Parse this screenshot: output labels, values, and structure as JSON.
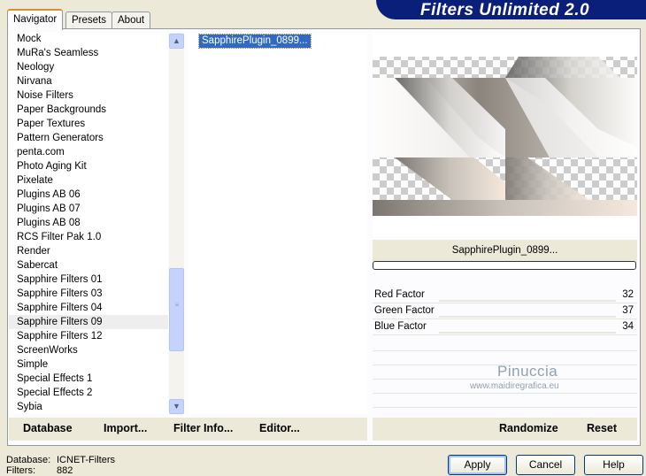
{
  "tabs": [
    {
      "label": "Navigator",
      "active": true
    },
    {
      "label": "Presets",
      "active": false
    },
    {
      "label": "About",
      "active": false
    }
  ],
  "header": {
    "title": "Filters Unlimited 2.0",
    "color": "#0a1f7a"
  },
  "categories": {
    "items": [
      "Mock",
      "MuRa's Seamless",
      "Neology",
      "Nirvana",
      "Noise Filters",
      "Paper Backgrounds",
      "Paper Textures",
      "Pattern Generators",
      "penta.com",
      "Photo Aging Kit",
      "Pixelate",
      "Plugins AB 06",
      "Plugins AB 07",
      "Plugins AB 08",
      "RCS Filter Pak 1.0",
      "Render",
      "Sabercat",
      "Sapphire Filters 01",
      "Sapphire Filters 03",
      "Sapphire Filters 04",
      "Sapphire Filters 09",
      "Sapphire Filters 12",
      "ScreenWorks",
      "Simple",
      "Special Effects 1",
      "Special Effects 2",
      "Sybia"
    ],
    "selected": "Sapphire Filters 09"
  },
  "filters": {
    "selected": "SapphirePlugin_0899..."
  },
  "preview": {
    "filter_name": "SapphirePlugin_0899...",
    "progress": 0
  },
  "params": [
    {
      "label": "Red Factor",
      "value": "32"
    },
    {
      "label": "Green Factor",
      "value": "37"
    },
    {
      "label": "Blue Factor",
      "value": "34"
    }
  ],
  "watermark": {
    "name": "Pinuccia",
    "site": "www.maidiregrafica.eu"
  },
  "toolbar": {
    "database": "Database",
    "import": "Import...",
    "filter_info": "Filter Info...",
    "editor": "Editor...",
    "randomize": "Randomize",
    "reset": "Reset"
  },
  "status": {
    "database_label": "Database:",
    "database_value": "ICNET-Filters",
    "filters_label": "Filters:",
    "filters_value": "882"
  },
  "buttons": {
    "apply": "Apply",
    "cancel": "Cancel",
    "help": "Help"
  },
  "colors": {
    "selection": "#316ac5",
    "accent": "#e68b2c",
    "face": "#ece9d8"
  }
}
